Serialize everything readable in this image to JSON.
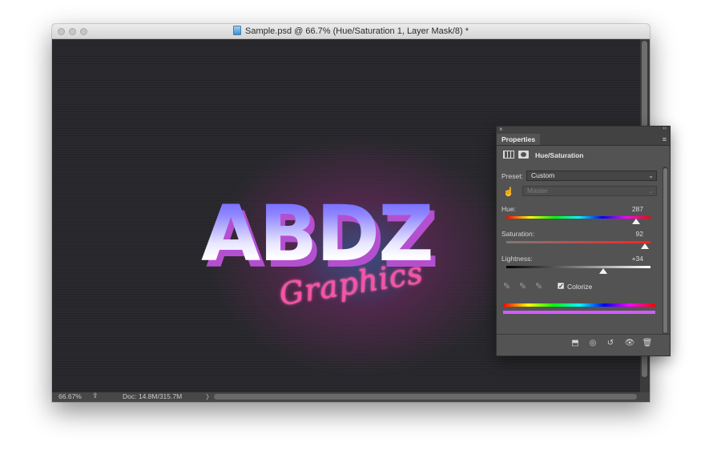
{
  "window": {
    "title": "Sample.psd @ 66.7% (Hue/Saturation 1, Layer Mask/8) *"
  },
  "artwork": {
    "headline": "ABDZ",
    "script": "Graphics"
  },
  "statusbar": {
    "zoom": "66.67%",
    "doc_info": "Doc: 14.8M/315.7M",
    "arrow": "〉"
  },
  "panel": {
    "tab": "Properties",
    "adjustment_title": "Hue/Saturation",
    "preset_label": "Preset:",
    "preset_value": "Custom",
    "channel_value": "Master",
    "hue_label": "Hue:",
    "hue_value": "287",
    "hue_fraction": 0.898,
    "saturation_label": "Saturation:",
    "saturation_value": "92",
    "saturation_fraction": 0.96,
    "lightness_label": "Lightness:",
    "lightness_value": "+34",
    "lightness_fraction": 0.67,
    "colorize_label": "Colorize",
    "colorize_checked": true,
    "result_color": "#d45bff"
  },
  "icons": {
    "close": "×",
    "collapse": "‹‹",
    "menu": "≡",
    "chevron": "⌄",
    "hand": "☝",
    "eyedropper": "✎",
    "clip": "⬒",
    "view_previous": "◎",
    "reset": "↺",
    "visibility": "👁",
    "trash": "🗑",
    "share": "⇪",
    "check": "✓"
  }
}
